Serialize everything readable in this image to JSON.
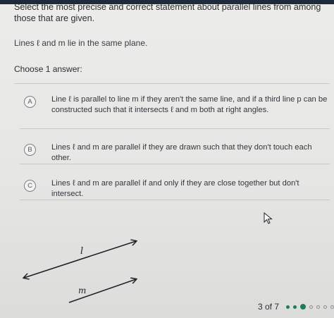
{
  "question": {
    "text": "Select the most precise and correct statement about parallel lines from among those that are given.",
    "statement": "Lines ℓ and m lie in the same plane.",
    "prompt": "Choose 1 answer:"
  },
  "choices": [
    {
      "letter": "A",
      "text": "Line ℓ is parallel to line m if they aren't the same line, and if a third line p can be constructed such that it intersects ℓ and m both at right angles."
    },
    {
      "letter": "B",
      "text": "Lines ℓ and m are parallel if they are drawn such that they don't touch each other."
    },
    {
      "letter": "C",
      "text": "Lines ℓ and m are parallel if and only if they are close together but don't intersect."
    }
  ],
  "figure": {
    "line1_label": "l",
    "line2_label": "m"
  },
  "pager": {
    "text": "3 of 7",
    "total_dots": 7,
    "current": 3
  },
  "colors": {
    "accent": "#1c7c5b",
    "line": "#1f2226",
    "topbar": "#1f2a3a"
  },
  "icons": {
    "cursor": "pointer-cursor-icon"
  }
}
